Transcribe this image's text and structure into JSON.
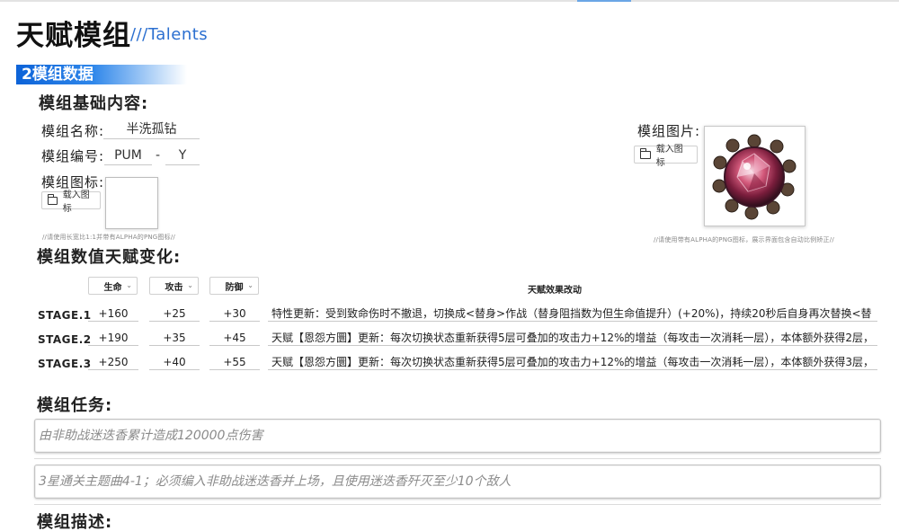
{
  "header": {
    "title": "天赋模组",
    "subtitle": "///Talents"
  },
  "section": {
    "label": "2模组数据"
  },
  "basic": {
    "heading": "模组基础内容:",
    "name_label": "模组名称:",
    "name_value": "半洗孤钻",
    "code_label": "模组编号:",
    "code_prefix": "PUM",
    "code_sep": "-",
    "code_suffix": "Y",
    "icon_label": "模组图标:",
    "load_icon_label": "载入图标",
    "icon_hint": "//请使用长宽比1:1并带有ALPHA的PNG图标//",
    "image_label": "模组图片:",
    "load_image_label": "载入图标",
    "image_hint": "//请使用带有ALPHA的PNG图标，展示界面包含自动比例矫正//"
  },
  "stats": {
    "heading": "模组数值天赋变化:",
    "columns": [
      "生命",
      "攻击",
      "防御"
    ],
    "effect_header": "天赋效果改动",
    "rows": [
      {
        "stage": "STAGE.1",
        "hp": "+160",
        "atk": "+25",
        "def": "+30",
        "effect": "特性更新：受到致命伤时不撤退，切换成<替身>作战（替身阻挡数为但生命值提升）(+20%)，持续20秒后自身再次替换<替"
      },
      {
        "stage": "STAGE.2",
        "hp": "+190",
        "atk": "+35",
        "def": "+45",
        "effect": "天赋【恩怨方圜】更新：每次切换状态重新获得5层可叠加的攻击力+12%的增益（每攻击一次消耗一层），本体额外获得2层，"
      },
      {
        "stage": "STAGE.3",
        "hp": "+250",
        "atk": "+40",
        "def": "+55",
        "effect": "天赋【恩怨方圜】更新：每次切换状态重新获得5层可叠加的攻击力+12%的增益（每攻击一次消耗一层），本体额外获得3层，"
      }
    ]
  },
  "tasks": {
    "heading": "模组任务:",
    "items": [
      "由非助战迷迭香累计造成120000点伤害",
      "3星通关主题曲4-1；必须编入非助战迷迭香并上场，且使用迷迭香歼灭至少10个敌人"
    ]
  },
  "description": {
    "heading": "模组描述:"
  },
  "colors": {
    "accent": "#2b6fd0",
    "section_bar": "#0d63d8"
  }
}
